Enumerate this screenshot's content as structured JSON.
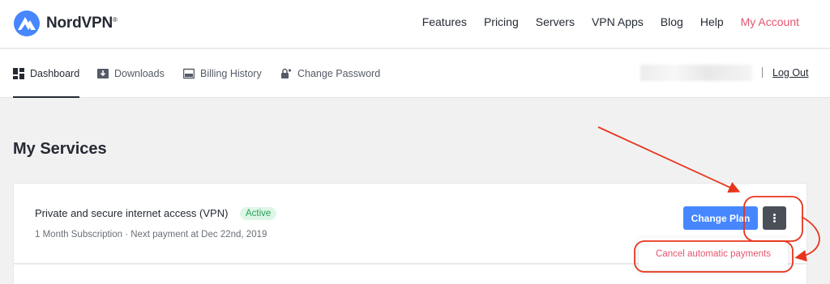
{
  "brand": {
    "name": "NordVPN",
    "mark": "®",
    "logo_icon": "nordvpn-mountain-logo"
  },
  "nav": {
    "items": [
      {
        "label": "Features"
      },
      {
        "label": "Pricing"
      },
      {
        "label": "Servers"
      },
      {
        "label": "VPN Apps"
      },
      {
        "label": "Blog"
      },
      {
        "label": "Help"
      },
      {
        "label": "My Account"
      }
    ]
  },
  "tabs": [
    {
      "label": "Dashboard",
      "icon": "dashboard-icon",
      "active": true
    },
    {
      "label": "Downloads",
      "icon": "download-icon"
    },
    {
      "label": "Billing History",
      "icon": "billing-icon"
    },
    {
      "label": "Change Password",
      "icon": "key-lock-icon"
    }
  ],
  "account": {
    "logout_label": "Log Out"
  },
  "page": {
    "title": "My Services"
  },
  "service": {
    "name": "Private and secure internet access (VPN)",
    "status": "Active",
    "subtitle": "1 Month Subscription · Next payment at Dec 22nd, 2019",
    "change_plan_label": "Change Plan",
    "more_icon": "vertical-ellipsis-icon"
  },
  "dropdown": {
    "cancel_label": "Cancel automatic payments"
  },
  "colors": {
    "accent": "#e5566e",
    "primary": "#4687ff",
    "active_badge": "#21a35a",
    "annotation": "#e8341c"
  }
}
